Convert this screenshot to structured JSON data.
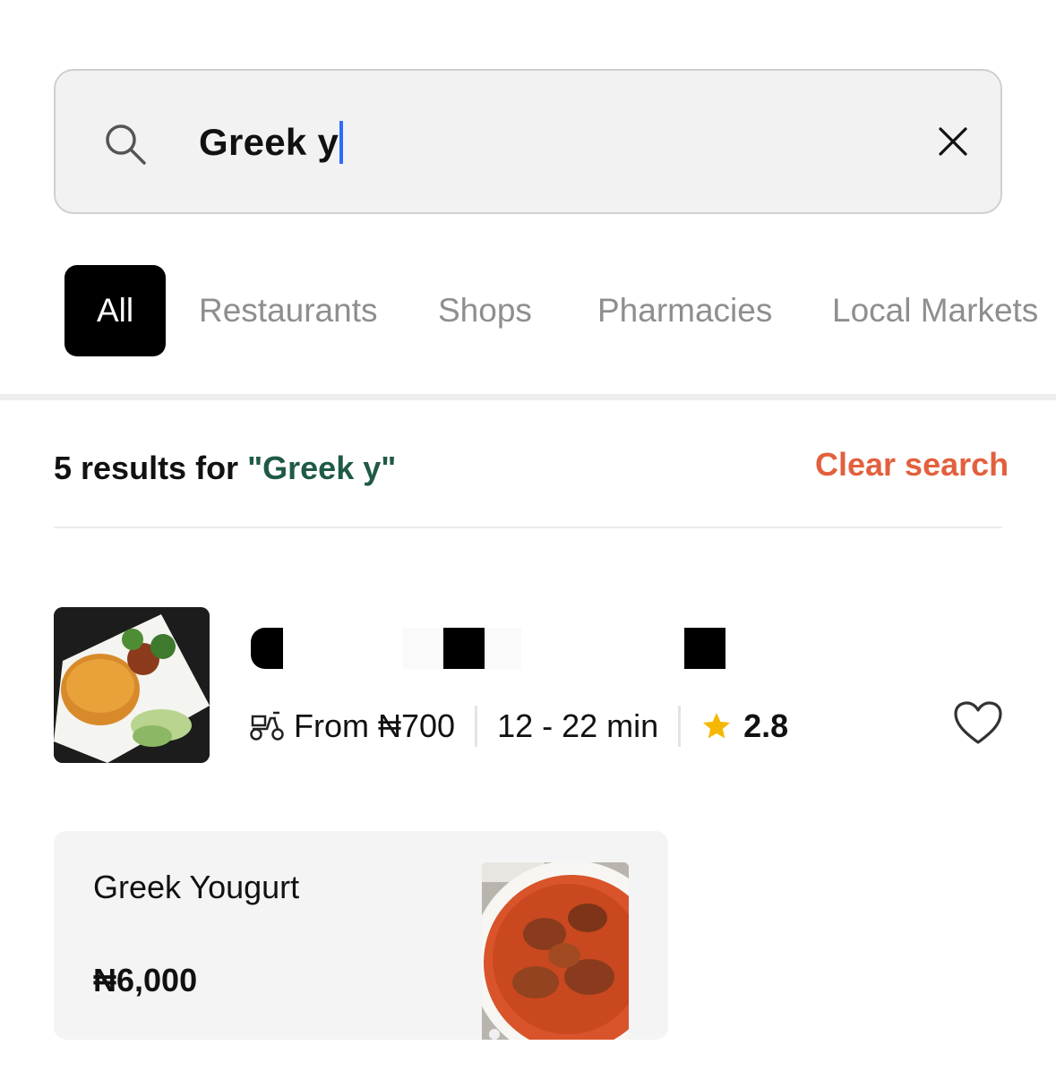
{
  "search": {
    "value": "Greek y",
    "icon": "search-icon",
    "clear_icon": "close-icon"
  },
  "tabs": [
    {
      "label": "All",
      "active": true
    },
    {
      "label": "Restaurants",
      "active": false
    },
    {
      "label": "Shops",
      "active": false
    },
    {
      "label": "Pharmacies",
      "active": false
    },
    {
      "label": "Local Markets",
      "active": false
    }
  ],
  "results": {
    "summary_prefix": "5 results for ",
    "query_quoted": "\"Greek y\"",
    "clear_label": "Clear search"
  },
  "restaurant": {
    "delivery_fee": "From ₦700",
    "eta": "12 - 22 min",
    "rating": "2.8",
    "delivery_icon": "scooter-icon",
    "rating_icon": "star-icon",
    "favorite_icon": "heart-icon"
  },
  "dish": {
    "name": "Greek Yougurt",
    "price": "₦6,000"
  },
  "colors": {
    "accent_clear": "#e2603e",
    "query_green": "#1f5a46",
    "star": "#f5b800",
    "caret": "#2f6bff"
  }
}
